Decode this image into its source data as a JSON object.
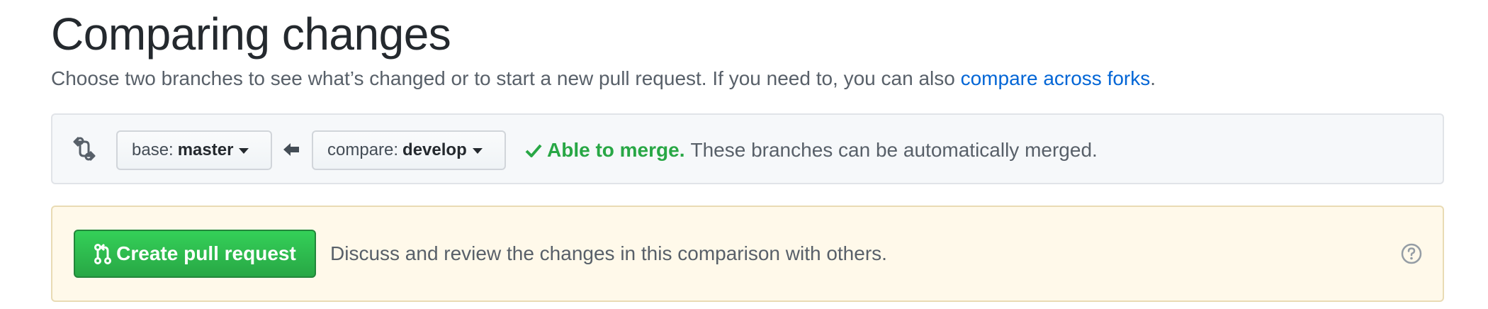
{
  "header": {
    "title": "Comparing changes",
    "subtitle_prefix": "Choose two branches to see what’s changed or to start a new pull request. If you need to, you can also ",
    "subtitle_link": "compare across forks",
    "subtitle_suffix": "."
  },
  "range": {
    "base_prefix": "base:",
    "base_branch": "master",
    "compare_prefix": "compare:",
    "compare_branch": "develop",
    "merge_status_ok": "Able to merge.",
    "merge_status_detail": "These branches can be automatically merged."
  },
  "pull_request": {
    "button_label": "Create pull request",
    "description": "Discuss and review the changes in this comparison with others."
  },
  "colors": {
    "link": "#0366d6",
    "success": "#28a745",
    "pr_box_bg": "#fff9ea",
    "range_box_bg": "#f6f8fa"
  },
  "icons": [
    "git-compare-icon",
    "arrow-left-icon",
    "check-icon",
    "git-pull-request-icon",
    "question-icon",
    "caret-down-icon"
  ]
}
